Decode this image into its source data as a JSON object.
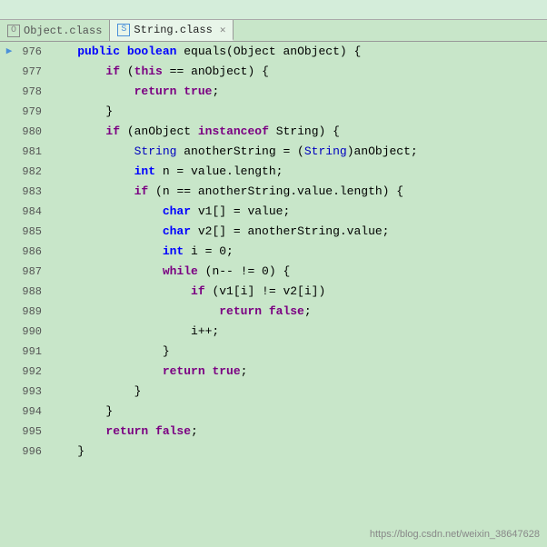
{
  "tabs": [
    {
      "id": "object-class",
      "label": "Object.class",
      "icon": "O",
      "active": false
    },
    {
      "id": "string-class",
      "label": "String.class",
      "icon": "S",
      "active": true
    }
  ],
  "lines": [
    {
      "num": "976",
      "marker": "▶",
      "content": [
        {
          "t": "\t",
          "c": "plain"
        },
        {
          "t": "public ",
          "c": "kw2"
        },
        {
          "t": "boolean ",
          "c": "kw2"
        },
        {
          "t": "equals(Object anObject) {",
          "c": "plain"
        }
      ]
    },
    {
      "num": "977",
      "marker": "",
      "content": [
        {
          "t": "\t\t",
          "c": "plain"
        },
        {
          "t": "if",
          "c": "kw"
        },
        {
          "t": " (",
          "c": "plain"
        },
        {
          "t": "this",
          "c": "kw"
        },
        {
          "t": " == anObject) {",
          "c": "plain"
        }
      ]
    },
    {
      "num": "978",
      "marker": "",
      "content": [
        {
          "t": "\t\t\t",
          "c": "plain"
        },
        {
          "t": "return ",
          "c": "kw"
        },
        {
          "t": "true",
          "c": "kw"
        },
        {
          "t": ";",
          "c": "plain"
        }
      ]
    },
    {
      "num": "979",
      "marker": "",
      "content": [
        {
          "t": "\t\t}",
          "c": "plain"
        }
      ]
    },
    {
      "num": "980",
      "marker": "",
      "content": [
        {
          "t": "\t\t",
          "c": "plain"
        },
        {
          "t": "if",
          "c": "kw"
        },
        {
          "t": " (anObject ",
          "c": "plain"
        },
        {
          "t": "instanceof ",
          "c": "kw"
        },
        {
          "t": "String) {",
          "c": "plain"
        }
      ]
    },
    {
      "num": "981",
      "marker": "",
      "content": [
        {
          "t": "\t\t\t",
          "c": "plain"
        },
        {
          "t": "String",
          "c": "classname"
        },
        {
          "t": " anotherString = (",
          "c": "plain"
        },
        {
          "t": "String",
          "c": "classname"
        },
        {
          "t": ")anObject;",
          "c": "plain"
        }
      ]
    },
    {
      "num": "982",
      "marker": "",
      "content": [
        {
          "t": "\t\t\t",
          "c": "plain"
        },
        {
          "t": "int",
          "c": "kw2"
        },
        {
          "t": " n = value.length;",
          "c": "plain"
        }
      ]
    },
    {
      "num": "983",
      "marker": "",
      "content": [
        {
          "t": "\t\t\t",
          "c": "plain"
        },
        {
          "t": "if",
          "c": "kw"
        },
        {
          "t": " (n == anotherString.value.length) {",
          "c": "plain"
        }
      ]
    },
    {
      "num": "984",
      "marker": "",
      "content": [
        {
          "t": "\t\t\t\t",
          "c": "plain"
        },
        {
          "t": "char",
          "c": "kw2"
        },
        {
          "t": " v1[] = value;",
          "c": "plain"
        }
      ]
    },
    {
      "num": "985",
      "marker": "",
      "content": [
        {
          "t": "\t\t\t\t",
          "c": "plain"
        },
        {
          "t": "char",
          "c": "kw2"
        },
        {
          "t": " v2[] = anotherString.value;",
          "c": "plain"
        }
      ]
    },
    {
      "num": "986",
      "marker": "",
      "content": [
        {
          "t": "\t\t\t\t",
          "c": "plain"
        },
        {
          "t": "int",
          "c": "kw2"
        },
        {
          "t": " i = 0;",
          "c": "plain"
        }
      ]
    },
    {
      "num": "987",
      "marker": "",
      "content": [
        {
          "t": "\t\t\t\t",
          "c": "plain"
        },
        {
          "t": "while",
          "c": "kw"
        },
        {
          "t": " (n-- != 0) {",
          "c": "plain"
        }
      ]
    },
    {
      "num": "988",
      "marker": "",
      "content": [
        {
          "t": "\t\t\t\t\t",
          "c": "plain"
        },
        {
          "t": "if",
          "c": "kw"
        },
        {
          "t": " (v1[i] != v2[i])",
          "c": "plain"
        }
      ]
    },
    {
      "num": "989",
      "marker": "",
      "content": [
        {
          "t": "\t\t\t\t\t\t",
          "c": "plain"
        },
        {
          "t": "return ",
          "c": "kw"
        },
        {
          "t": "false",
          "c": "kw"
        },
        {
          "t": ";",
          "c": "plain"
        }
      ]
    },
    {
      "num": "990",
      "marker": "",
      "content": [
        {
          "t": "\t\t\t\t\t",
          "c": "plain"
        },
        {
          "t": "i++;",
          "c": "plain"
        }
      ]
    },
    {
      "num": "991",
      "marker": "",
      "content": [
        {
          "t": "\t\t\t\t}",
          "c": "plain"
        }
      ]
    },
    {
      "num": "992",
      "marker": "",
      "content": [
        {
          "t": "\t\t\t\t",
          "c": "plain"
        },
        {
          "t": "return ",
          "c": "kw"
        },
        {
          "t": "true",
          "c": "kw"
        },
        {
          "t": ";",
          "c": "plain"
        }
      ]
    },
    {
      "num": "993",
      "marker": "",
      "content": [
        {
          "t": "\t\t\t}",
          "c": "plain"
        }
      ]
    },
    {
      "num": "994",
      "marker": "",
      "content": [
        {
          "t": "\t\t}",
          "c": "plain"
        }
      ]
    },
    {
      "num": "995",
      "marker": "",
      "content": [
        {
          "t": "\t\t",
          "c": "plain"
        },
        {
          "t": "return ",
          "c": "kw"
        },
        {
          "t": "false",
          "c": "kw"
        },
        {
          "t": ";",
          "c": "plain"
        }
      ]
    },
    {
      "num": "996",
      "marker": "",
      "content": [
        {
          "t": "\t}",
          "c": "plain"
        }
      ]
    }
  ],
  "watermark": "https://blog.csdn.net/weixin_38647628"
}
